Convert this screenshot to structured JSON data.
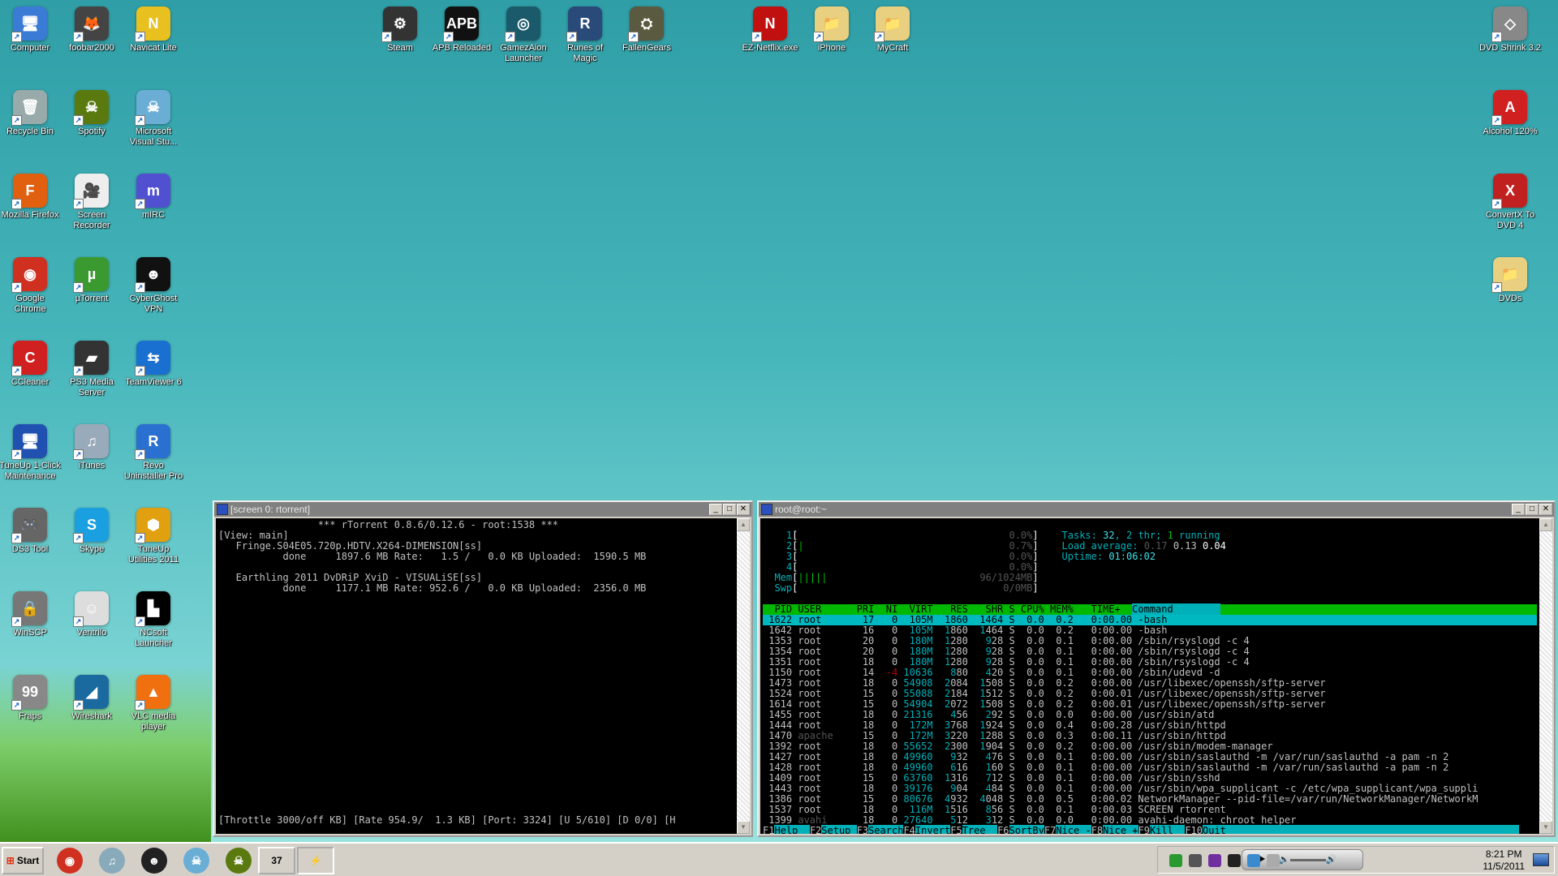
{
  "desktop": {
    "left_grid": [
      {
        "label": "Computer",
        "glyph": "🖥",
        "color": "#3a7bd5"
      },
      {
        "label": "foobar2000",
        "glyph": "🦊",
        "color": "#444"
      },
      {
        "label": "Navicat Lite",
        "glyph": "N",
        "color": "#e8c020"
      },
      {
        "label": "Recycle Bin",
        "glyph": "🗑",
        "color": "#9aa"
      },
      {
        "label": "Spotify",
        "glyph": "☠",
        "color": "#5a7a10"
      },
      {
        "label": "Microsoft Visual Stu...",
        "glyph": "☠",
        "color": "#6aaed6"
      },
      {
        "label": "Mozilla Firefox",
        "glyph": "F",
        "color": "#e06010"
      },
      {
        "label": "Screen Recorder",
        "glyph": "🎥",
        "color": "#eee"
      },
      {
        "label": "mIRC",
        "glyph": "m",
        "color": "#5050d0"
      },
      {
        "label": "Google Chrome",
        "glyph": "◉",
        "color": "#d03020"
      },
      {
        "label": "µTorrent",
        "glyph": "µ",
        "color": "#3a9a30"
      },
      {
        "label": "CyberGhost VPN",
        "glyph": "☻",
        "color": "#111"
      },
      {
        "label": "CCleaner",
        "glyph": "C",
        "color": "#d02020"
      },
      {
        "label": "PS3 Media Server",
        "glyph": "▰",
        "color": "#333"
      },
      {
        "label": "TeamViewer 6",
        "glyph": "⇆",
        "color": "#1a70d0"
      },
      {
        "label": "TuneUp 1-Click Maintenance",
        "glyph": "🖥",
        "color": "#2050b0"
      },
      {
        "label": "iTunes",
        "glyph": "♫",
        "color": "#9ab"
      },
      {
        "label": "Revo Uninstaller Pro",
        "glyph": "R",
        "color": "#2a70d0"
      },
      {
        "label": "DS3 Tool",
        "glyph": "🎮",
        "color": "#666"
      },
      {
        "label": "Skype",
        "glyph": "S",
        "color": "#1aa0e0"
      },
      {
        "label": "TuneUp Utilities 2011",
        "glyph": "⬢",
        "color": "#e0a010"
      },
      {
        "label": "WinSCP",
        "glyph": "🔒",
        "color": "#777"
      },
      {
        "label": "Ventrilo",
        "glyph": "☺",
        "color": "#ddd"
      },
      {
        "label": "NCsoft Launcher",
        "glyph": "▙",
        "color": "#000"
      },
      {
        "label": "Fraps",
        "glyph": "99",
        "color": "#888"
      },
      {
        "label": "Wireshark",
        "glyph": "◢",
        "color": "#1a6aa0"
      },
      {
        "label": "VLC media player",
        "glyph": "▲",
        "color": "#f07010"
      }
    ],
    "top_row": [
      {
        "label": "Steam",
        "glyph": "⚙",
        "color": "#333"
      },
      {
        "label": "APB Reloaded",
        "glyph": "APB",
        "color": "#111"
      },
      {
        "label": "GamezAion Launcher",
        "glyph": "◎",
        "color": "#1a5a6a"
      },
      {
        "label": "Runes of Magic",
        "glyph": "R",
        "color": "#2a4a7a"
      },
      {
        "label": "FallenGears",
        "glyph": "⛭",
        "color": "#5a5a40"
      },
      {
        "label": "EZ-Netflix.exe",
        "glyph": "N",
        "color": "#c01010"
      },
      {
        "label": "iPhone",
        "glyph": "📁",
        "color": "#e8d080"
      },
      {
        "label": "MyCraft",
        "glyph": "📁",
        "color": "#e8d080"
      }
    ],
    "right_col": [
      {
        "label": "DVD Shrink 3.2",
        "glyph": "◇",
        "color": "#888"
      },
      {
        "label": "Alcohol 120%",
        "glyph": "A",
        "color": "#d02020"
      },
      {
        "label": "ConvertX To DVD 4",
        "glyph": "X",
        "color": "#c02020"
      },
      {
        "label": "DVDs",
        "glyph": "📁",
        "color": "#e8d080"
      }
    ]
  },
  "rtorrent": {
    "title": "[screen 0: rtorrent]",
    "header": "*** rTorrent 0.8.6/0.12.6 - root:1538 ***",
    "view": "[View: main]",
    "torrents": [
      {
        "name": "Fringe.S04E05.720p.HDTV.X264-DIMENSION[ss]",
        "state": "done",
        "size": "1897.6 MB",
        "rate": "Rate:   1.5 /   0.0 KB",
        "uploaded": "Uploaded:  1590.5 MB"
      },
      {
        "name": "Earthling 2011 DvDRiP XviD - VISUALiSE[ss]",
        "state": "done",
        "size": "1177.1 MB",
        "rate": "Rate: 952.6 /   0.0 KB",
        "uploaded": "Uploaded:  2356.0 MB"
      }
    ],
    "status": "[Throttle 3000/off KB] [Rate 954.9/  1.3 KB] [Port: 3324] [U 5/610] [D 0/0] [H"
  },
  "htop": {
    "title": "root@root:~",
    "meters": [
      {
        "label": "1",
        "bars": "",
        "value": "0.0%"
      },
      {
        "label": "2",
        "bars": "|",
        "value": "0.7%"
      },
      {
        "label": "3",
        "bars": "",
        "value": "0.0%"
      },
      {
        "label": "4",
        "bars": "",
        "value": "0.0%"
      },
      {
        "label": "Mem",
        "bars": "|||||",
        "value": "96/1024MB"
      },
      {
        "label": "Swp",
        "bars": "",
        "value": "0/0MB"
      }
    ],
    "tasks": {
      "prefix": "Tasks: ",
      "count": "32",
      "threads": ", 2 thr; ",
      "running": "1",
      "suffix": " running"
    },
    "load": {
      "label": "Load average: ",
      "l1": "0.17",
      "l5": "0.13",
      "l15": "0.04"
    },
    "uptime": {
      "label": "Uptime: ",
      "value": "01:06:02"
    },
    "columns": [
      "PID",
      "USER",
      "PRI",
      "NI",
      "VIRT",
      "RES",
      "SHR",
      "S",
      "CPU%",
      "MEM%",
      "TIME+",
      "Command"
    ],
    "processes": [
      [
        "1622",
        "root",
        "17",
        "0",
        "105M",
        "1860",
        "1464",
        "S",
        "0.0",
        "0.2",
        "0:00.00",
        "-bash"
      ],
      [
        "1642",
        "root",
        "16",
        "0",
        "105M",
        "1860",
        "1464",
        "S",
        "0.0",
        "0.2",
        "0:00.00",
        "-bash"
      ],
      [
        "1353",
        "root",
        "20",
        "0",
        "180M",
        "1280",
        "928",
        "S",
        "0.0",
        "0.1",
        "0:00.00",
        "/sbin/rsyslogd -c 4"
      ],
      [
        "1354",
        "root",
        "20",
        "0",
        "180M",
        "1280",
        "928",
        "S",
        "0.0",
        "0.1",
        "0:00.00",
        "/sbin/rsyslogd -c 4"
      ],
      [
        "1351",
        "root",
        "18",
        "0",
        "180M",
        "1280",
        "928",
        "S",
        "0.0",
        "0.1",
        "0:00.00",
        "/sbin/rsyslogd -c 4"
      ],
      [
        "1150",
        "root",
        "14",
        "-4",
        "10636",
        "880",
        "420",
        "S",
        "0.0",
        "0.1",
        "0:00.00",
        "/sbin/udevd -d"
      ],
      [
        "1473",
        "root",
        "18",
        "0",
        "54908",
        "2084",
        "1508",
        "S",
        "0.0",
        "0.2",
        "0:00.00",
        "/usr/libexec/openssh/sftp-server"
      ],
      [
        "1524",
        "root",
        "15",
        "0",
        "55088",
        "2184",
        "1512",
        "S",
        "0.0",
        "0.2",
        "0:00.01",
        "/usr/libexec/openssh/sftp-server"
      ],
      [
        "1614",
        "root",
        "15",
        "0",
        "54904",
        "2072",
        "1508",
        "S",
        "0.0",
        "0.2",
        "0:00.01",
        "/usr/libexec/openssh/sftp-server"
      ],
      [
        "1455",
        "root",
        "18",
        "0",
        "21316",
        "456",
        "292",
        "S",
        "0.0",
        "0.0",
        "0:00.00",
        "/usr/sbin/atd"
      ],
      [
        "1444",
        "root",
        "18",
        "0",
        "172M",
        "3768",
        "1924",
        "S",
        "0.0",
        "0.4",
        "0:00.28",
        "/usr/sbin/httpd"
      ],
      [
        "1470",
        "apache",
        "15",
        "0",
        "172M",
        "3220",
        "1288",
        "S",
        "0.0",
        "0.3",
        "0:00.11",
        "/usr/sbin/httpd"
      ],
      [
        "1392",
        "root",
        "18",
        "0",
        "55652",
        "2300",
        "1904",
        "S",
        "0.0",
        "0.2",
        "0:00.00",
        "/usr/sbin/modem-manager"
      ],
      [
        "1427",
        "root",
        "18",
        "0",
        "49960",
        "932",
        "476",
        "S",
        "0.0",
        "0.1",
        "0:00.00",
        "/usr/sbin/saslauthd -m /var/run/saslauthd -a pam -n 2"
      ],
      [
        "1428",
        "root",
        "18",
        "0",
        "49960",
        "616",
        "160",
        "S",
        "0.0",
        "0.1",
        "0:00.00",
        "/usr/sbin/saslauthd -m /var/run/saslauthd -a pam -n 2"
      ],
      [
        "1409",
        "root",
        "15",
        "0",
        "63760",
        "1316",
        "712",
        "S",
        "0.0",
        "0.1",
        "0:00.00",
        "/usr/sbin/sshd"
      ],
      [
        "1443",
        "root",
        "18",
        "0",
        "39176",
        "904",
        "484",
        "S",
        "0.0",
        "0.1",
        "0:00.00",
        "/usr/sbin/wpa_supplicant -c /etc/wpa_supplicant/wpa_suppli"
      ],
      [
        "1386",
        "root",
        "15",
        "0",
        "80676",
        "4932",
        "4048",
        "S",
        "0.0",
        "0.5",
        "0:00.02",
        "NetworkManager --pid-file=/var/run/NetworkManager/NetworkM"
      ],
      [
        "1537",
        "root",
        "18",
        "0",
        "116M",
        "1516",
        "856",
        "S",
        "0.0",
        "0.1",
        "0:00.03",
        "SCREEN rtorrent"
      ],
      [
        "1399",
        "avahi",
        "18",
        "0",
        "27640",
        "512",
        "312",
        "S",
        "0.0",
        "0.0",
        "0:00.00",
        "avahi-daemon: chroot helper"
      ]
    ],
    "fkeys": [
      [
        "F1",
        "Help  "
      ],
      [
        "F2",
        "Setup "
      ],
      [
        "F3",
        "Search"
      ],
      [
        "F4",
        "Invert"
      ],
      [
        "F5",
        "Tree  "
      ],
      [
        "F6",
        "SortBy"
      ],
      [
        "F7",
        "Nice -"
      ],
      [
        "F8",
        "Nice +"
      ],
      [
        "F9",
        "Kill  "
      ],
      [
        "F10",
        "Quit"
      ]
    ]
  },
  "taskbar": {
    "start_label": "Start",
    "quick_launch": [
      {
        "name": "chrome",
        "glyph": "◉",
        "color": "#d03020"
      },
      {
        "name": "itunes",
        "glyph": "♫",
        "color": "#8ab"
      },
      {
        "name": "cyberghost",
        "glyph": "☻",
        "color": "#222"
      },
      {
        "name": "visual-studio",
        "glyph": "☠",
        "color": "#6aaed6"
      },
      {
        "name": "spotify",
        "glyph": "☠",
        "color": "#5a7a10"
      }
    ],
    "windows": [
      {
        "name": "37-app",
        "glyph": "37"
      },
      {
        "name": "putty",
        "glyph": "⚡"
      }
    ],
    "tray": [
      {
        "name": "utorrent",
        "color": "#2a9a30"
      },
      {
        "name": "winscp",
        "color": "#555"
      },
      {
        "name": "mirc",
        "color": "#7030a0"
      },
      {
        "name": "steam",
        "color": "#222"
      },
      {
        "name": "messenger",
        "color": "#3a8ad0"
      },
      {
        "name": "signal",
        "color": "#aaa"
      }
    ],
    "clock": {
      "time": "8:21 PM",
      "date": "11/5/2011"
    }
  }
}
